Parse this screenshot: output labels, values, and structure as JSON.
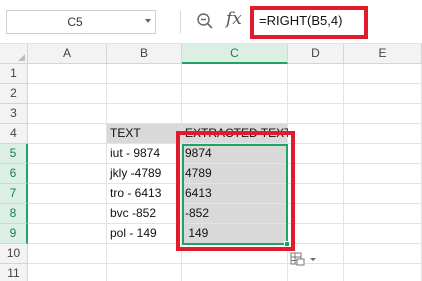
{
  "formula_bar": {
    "name_box": "C5",
    "fx_label": "fx",
    "formula": "=RIGHT(B5,4)"
  },
  "columns": [
    "A",
    "B",
    "C",
    "D",
    "E"
  ],
  "rows": [
    "1",
    "2",
    "3",
    "4",
    "5",
    "6",
    "7",
    "8",
    "9",
    "10",
    "11"
  ],
  "table": {
    "header_text": "TEXT",
    "header_extracted": "EXTRACTED TEXT",
    "text_values": [
      "iut - 9874",
      "jkly -4789",
      "tro - 6413",
      "bvc -852",
      "pol - 149"
    ],
    "extracted_values": [
      "9874",
      "4789",
      "6413",
      "-852",
      " 149"
    ]
  },
  "colors": {
    "annotation_red": "#e21b2b",
    "selection_green": "#21a366",
    "cell_shade": "#d9d9d9"
  }
}
